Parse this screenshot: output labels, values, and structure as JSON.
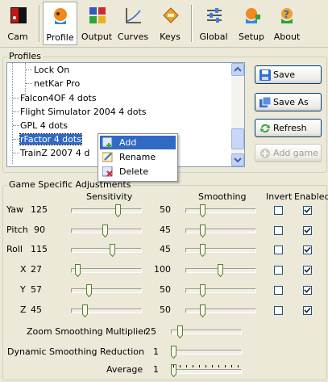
{
  "toolbar": {
    "items": [
      {
        "label": "Cam"
      },
      {
        "label": "Profile"
      },
      {
        "label": "Output"
      },
      {
        "label": "Curves"
      },
      {
        "label": "Keys"
      },
      {
        "label": "Global"
      },
      {
        "label": "Setup"
      },
      {
        "label": "About"
      }
    ],
    "active": "Profile"
  },
  "profiles": {
    "group_title": "Profiles",
    "items": [
      {
        "label": "Lock On"
      },
      {
        "label": "netKar Pro"
      },
      {
        "label": "Falcon4OF 4 dots"
      },
      {
        "label": "Flight Simulator 2004 4 dots"
      },
      {
        "label": "GPL 4 dots"
      },
      {
        "label": "rFactor 4 dots"
      },
      {
        "label": "TrainZ 2007 4 dots"
      }
    ],
    "selected": "rFactor 4 dots",
    "visible_item_texts": [
      "TrainZ 2007 4 d"
    ],
    "buttons": {
      "save": "Save",
      "save_as": "Save As",
      "refresh": "Refresh",
      "add_game": "Add game"
    }
  },
  "context_menu": {
    "items": [
      {
        "label": "Add"
      },
      {
        "label": "Rename"
      },
      {
        "label": "Delete"
      }
    ],
    "highlighted": "Add"
  },
  "game_specific": {
    "group_title": "Game Specific Adjustments",
    "headers": {
      "sensitivity": "Sensitivity",
      "smoothing": "Smoothing",
      "invert": "Invert",
      "enabled": "Enabled"
    },
    "axes": [
      {
        "name": "Yaw",
        "sensitivity": "125",
        "smoothing": "50",
        "invert": false,
        "enabled": true
      },
      {
        "name": "Pitch",
        "sensitivity": "90",
        "smoothing": "45",
        "invert": false,
        "enabled": true
      },
      {
        "name": "Roll",
        "sensitivity": "115",
        "smoothing": "45",
        "invert": false,
        "enabled": true
      },
      {
        "name": "X",
        "sensitivity": "27",
        "smoothing": "100",
        "invert": false,
        "enabled": true
      },
      {
        "name": "Y",
        "sensitivity": "57",
        "smoothing": "50",
        "invert": false,
        "enabled": true
      },
      {
        "name": "Z",
        "sensitivity": "45",
        "smoothing": "50",
        "invert": false,
        "enabled": true
      }
    ],
    "zoom_smoothing": {
      "label": "Zoom Smoothing Multiplier",
      "value": "25"
    },
    "dynamic_smoothing": {
      "label": "Dynamic Smoothing Reduction",
      "value": "1"
    },
    "average": {
      "label": "Average",
      "value": "1"
    }
  },
  "colors": {
    "accent": "#316ac5",
    "face": "#ece9d8"
  }
}
